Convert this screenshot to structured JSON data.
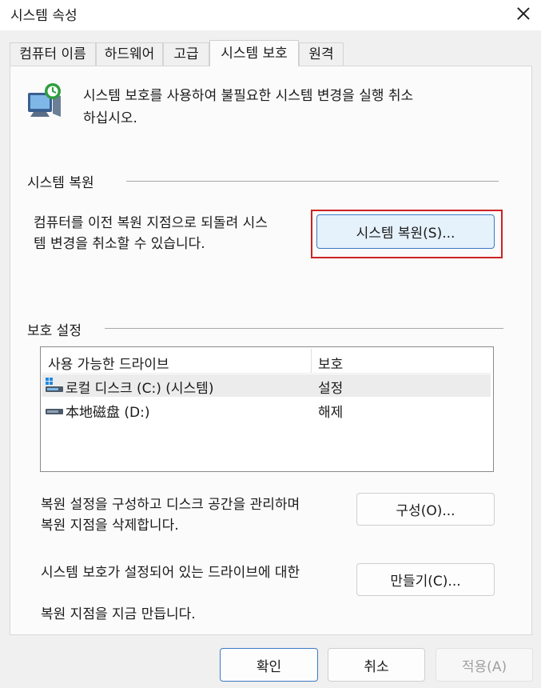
{
  "window": {
    "title": "시스템 속성"
  },
  "tabs": [
    {
      "label": "컴퓨터 이름"
    },
    {
      "label": "하드웨어"
    },
    {
      "label": "고급"
    },
    {
      "label": "시스템 보호"
    },
    {
      "label": "원격"
    }
  ],
  "intro": {
    "text": "시스템 보호를 사용하여 불필요한 시스템 변경을 실행 취소\n하십시오."
  },
  "restore_group": {
    "label": "시스템 복원",
    "description": "컴퓨터를 이전 복원 지점으로 되돌려 시스\n템 변경을 취소할 수 있습니다.",
    "button": "시스템 복원(S)..."
  },
  "protection_group": {
    "label": "보호 설정",
    "columns": [
      "사용 가능한 드라이브",
      "보호"
    ],
    "drives": [
      {
        "name": "로컬 디스크 (C:) (시스템)",
        "protection": "설정",
        "icon": "system-drive-icon"
      },
      {
        "name": "本地磁盘 (D:)",
        "protection": "해제",
        "icon": "drive-icon"
      }
    ],
    "configure_text": "복원 설정을 구성하고 디스크 공간을 관리하며\n복원 지점을 삭제합니다.",
    "configure_button": "구성(O)...",
    "create_text_1": "시스템 보호가 설정되어 있는 드라이브에 대한",
    "create_text_2": "복원 지점을 지금 만듭니다.",
    "create_button": "만들기(C)..."
  },
  "footer": {
    "ok": "확인",
    "cancel": "취소",
    "apply": "적용(A)"
  }
}
